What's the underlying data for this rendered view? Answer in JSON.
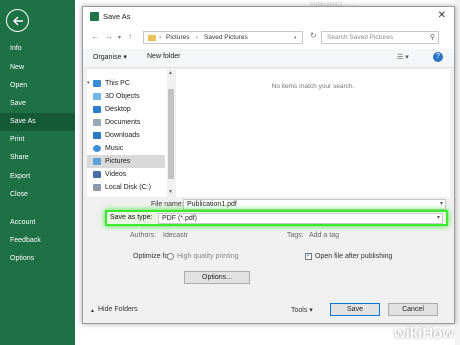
{
  "backstage": {
    "items": [
      "Info",
      "New",
      "Open",
      "Save",
      "Save As",
      "Print",
      "Share",
      "Export",
      "Close",
      "Account",
      "Feedback",
      "Options"
    ]
  },
  "app_title_fragment": "Publication1 - ...",
  "dialog": {
    "title": "Save As",
    "breadcrumb": [
      "Pictures",
      "Saved Pictures"
    ],
    "search_placeholder": "Search Saved Pictures",
    "toolbar": {
      "organise": "Organise",
      "new_folder": "New folder"
    },
    "nav_items": [
      {
        "label": "This PC",
        "icon": "computer-icon"
      },
      {
        "label": "3D Objects",
        "icon": "folder-3d-icon"
      },
      {
        "label": "Desktop",
        "icon": "desktop-icon"
      },
      {
        "label": "Documents",
        "icon": "documents-icon"
      },
      {
        "label": "Downloads",
        "icon": "downloads-icon"
      },
      {
        "label": "Music",
        "icon": "music-icon"
      },
      {
        "label": "Pictures",
        "icon": "pictures-icon"
      },
      {
        "label": "Videos",
        "icon": "videos-icon"
      },
      {
        "label": "Local Disk (C:)",
        "icon": "disk-icon"
      }
    ],
    "empty_message": "No items match your search.",
    "file_name_label": "File name:",
    "file_name_value": "Publication1.pdf",
    "save_type_label": "Save as type:",
    "save_type_value": "PDF (*.pdf)",
    "authors_label": "Authors:",
    "authors_value": "Idecastr",
    "tags_label": "Tags:",
    "tags_value": "Add a tag",
    "optimize_label": "Optimize for:",
    "optimize_value": "High quality printing",
    "open_after_label": "Open file after publishing",
    "options_button": "Options...",
    "hide_folders": "Hide Folders",
    "tools_label": "Tools",
    "save_button": "Save",
    "cancel_button": "Cancel"
  },
  "watermark": "wikiHow"
}
